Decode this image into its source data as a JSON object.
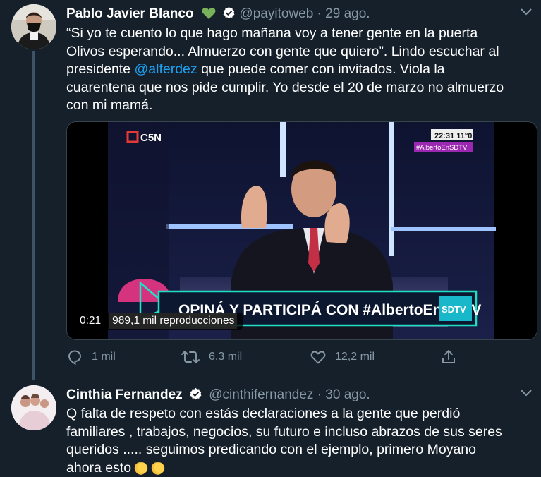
{
  "tweet1": {
    "name": "Pablo Javier Blanco",
    "handle": "@payitoweb",
    "date": "· 29 ago.",
    "text_line1": "“Si yo te cuento lo que hago mañana voy a tener gente en la puerta",
    "text_line2": "Olivos esperando... Almuerzo con gente que quiero”. Lindo escuchar al",
    "text_line3a": "presidente ",
    "text_mention": "@alferdez",
    "text_line3b": " que puede comer con invitados. Viola la",
    "text_line4": "cuarentena que nos pide cumplir. Yo desde el 20 de marzo no almuerzo",
    "text_line5": "con mi mamá.",
    "video": {
      "channel": "C5N",
      "clock": "22:31  11°0",
      "hashtag_tag": "#AlbertoEnSDTV",
      "banner": "OPINÁ Y PARTICIPÁ CON #AlbertoEnSDTV",
      "logo": "SDTV",
      "time": "0:21",
      "views": "989,1 mil reproducciones"
    },
    "actions": {
      "replies": "1 mil",
      "retweets": "6,3 mil",
      "likes": "12,2 mil"
    }
  },
  "tweet2": {
    "name": "Cinthia Fernandez",
    "handle": "@cinthifernandez",
    "date": "· 30 ago.",
    "text_line1": "Q falta de respeto con estás declaraciones  a la gente que perdió",
    "text_line2": "familiares , trabajos, negocios, su futuro e incluso abrazos de sus seres",
    "text_line3": "queridos ..... seguimos predicando con el ejemplo, primero Moyano",
    "text_line4": "ahora esto"
  },
  "colors": {
    "background": "#15202b",
    "secondary_text": "#8899a6",
    "link": "#1da1f2",
    "verified": "#1da1f2",
    "heart": "#78b159"
  }
}
